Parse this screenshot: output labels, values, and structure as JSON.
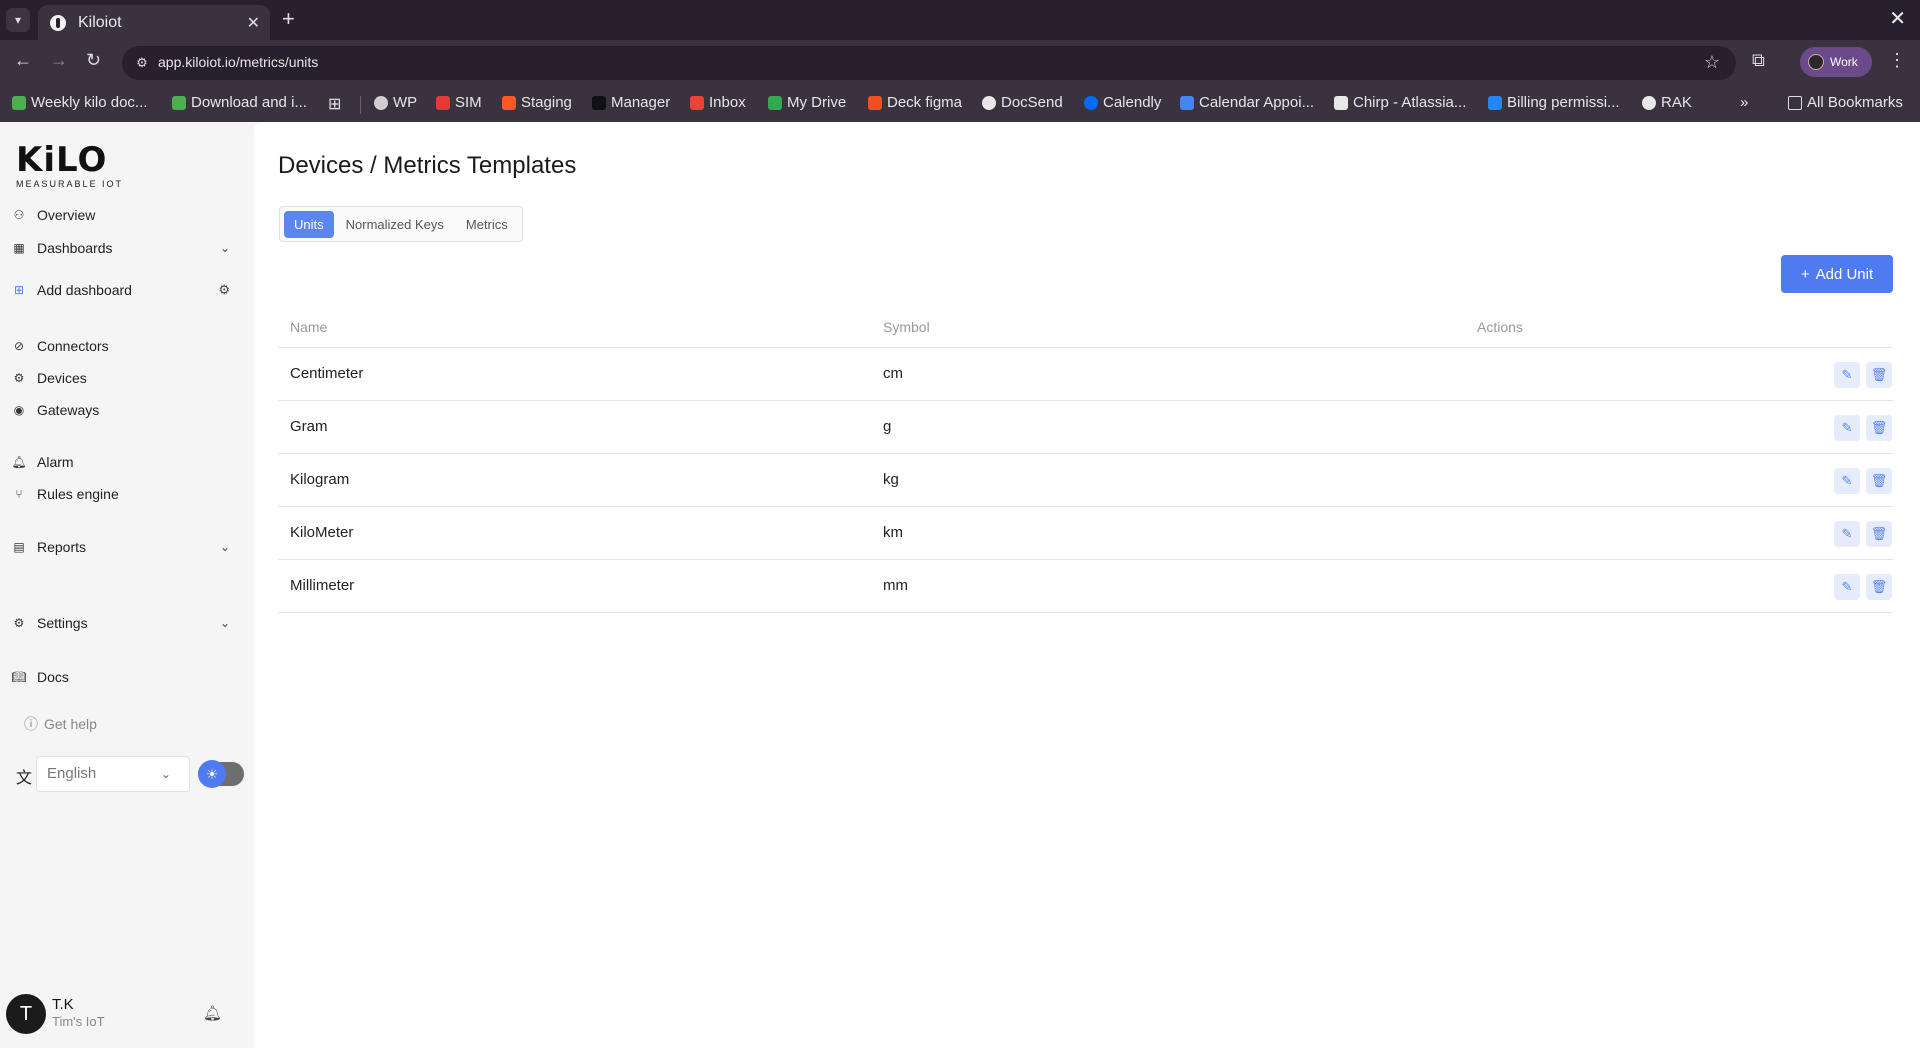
{
  "browser": {
    "tab_title": "Kiloiot",
    "url": "app.kiloiot.io/metrics/units",
    "profile_label": "Work",
    "bookmarks": [
      {
        "label": "Weekly kilo doc...",
        "color": "#4caf50"
      },
      {
        "label": "Download and i...",
        "color": "#4caf50"
      },
      {
        "label": "WP",
        "color": "#cfcfcf"
      },
      {
        "label": "SIM",
        "color": "#e53935"
      },
      {
        "label": "Staging",
        "color": "#ff5722"
      },
      {
        "label": "Manager",
        "color": "#111111"
      },
      {
        "label": "Inbox",
        "color": "#ea4335"
      },
      {
        "label": "My Drive",
        "color": "#34a853"
      },
      {
        "label": "Deck figma",
        "color": "#f24e1e"
      },
      {
        "label": "DocSend",
        "color": "#e8e8e8"
      },
      {
        "label": "Calendly",
        "color": "#006bff"
      },
      {
        "label": "Calendar Appoi...",
        "color": "#4285f4"
      },
      {
        "label": "Chirp - Atlassia...",
        "color": "#e8e8e8"
      },
      {
        "label": "Billing permissi...",
        "color": "#2684ff"
      },
      {
        "label": "RAK",
        "color": "#e8e8e8"
      }
    ],
    "all_bookmarks_label": "All Bookmarks"
  },
  "logo": {
    "main": "KiLO",
    "sub": "MEASURABLE IOT"
  },
  "sidebar": {
    "items": [
      {
        "label": "Overview",
        "icon": "user-icon"
      },
      {
        "label": "Dashboards",
        "icon": "layout-icon"
      },
      {
        "label": "Add dashboard",
        "icon": "plus-square-icon"
      },
      {
        "label": "Connectors",
        "icon": "connector-icon"
      },
      {
        "label": "Devices",
        "icon": "chip-icon"
      },
      {
        "label": "Gateways",
        "icon": "antenna-icon"
      },
      {
        "label": "Alarm",
        "icon": "bell-icon"
      },
      {
        "label": "Rules engine",
        "icon": "branch-icon"
      },
      {
        "label": "Reports",
        "icon": "report-icon"
      },
      {
        "label": "Settings",
        "icon": "gear-icon"
      },
      {
        "label": "Docs",
        "icon": "book-icon"
      }
    ],
    "help": "Get help",
    "language": "English"
  },
  "user": {
    "initial": "T",
    "name": "T.K",
    "org": "Tim's IoT"
  },
  "main": {
    "title": "Devices / Metrics Templates",
    "tabs": [
      {
        "label": "Units",
        "active": true
      },
      {
        "label": "Normalized Keys",
        "active": false
      },
      {
        "label": "Metrics",
        "active": false
      }
    ],
    "add_button": "Add Unit",
    "columns": [
      "Name",
      "Symbol",
      "Actions"
    ],
    "rows": [
      {
        "name": "Centimeter",
        "symbol": "cm"
      },
      {
        "name": "Gram",
        "symbol": "g"
      },
      {
        "name": "Kilogram",
        "symbol": "kg"
      },
      {
        "name": "KiloMeter",
        "symbol": "km"
      },
      {
        "name": "Millimeter",
        "symbol": "mm"
      }
    ]
  },
  "colors": {
    "accent": "#4f7bf0",
    "chrome": "#3b3240"
  }
}
